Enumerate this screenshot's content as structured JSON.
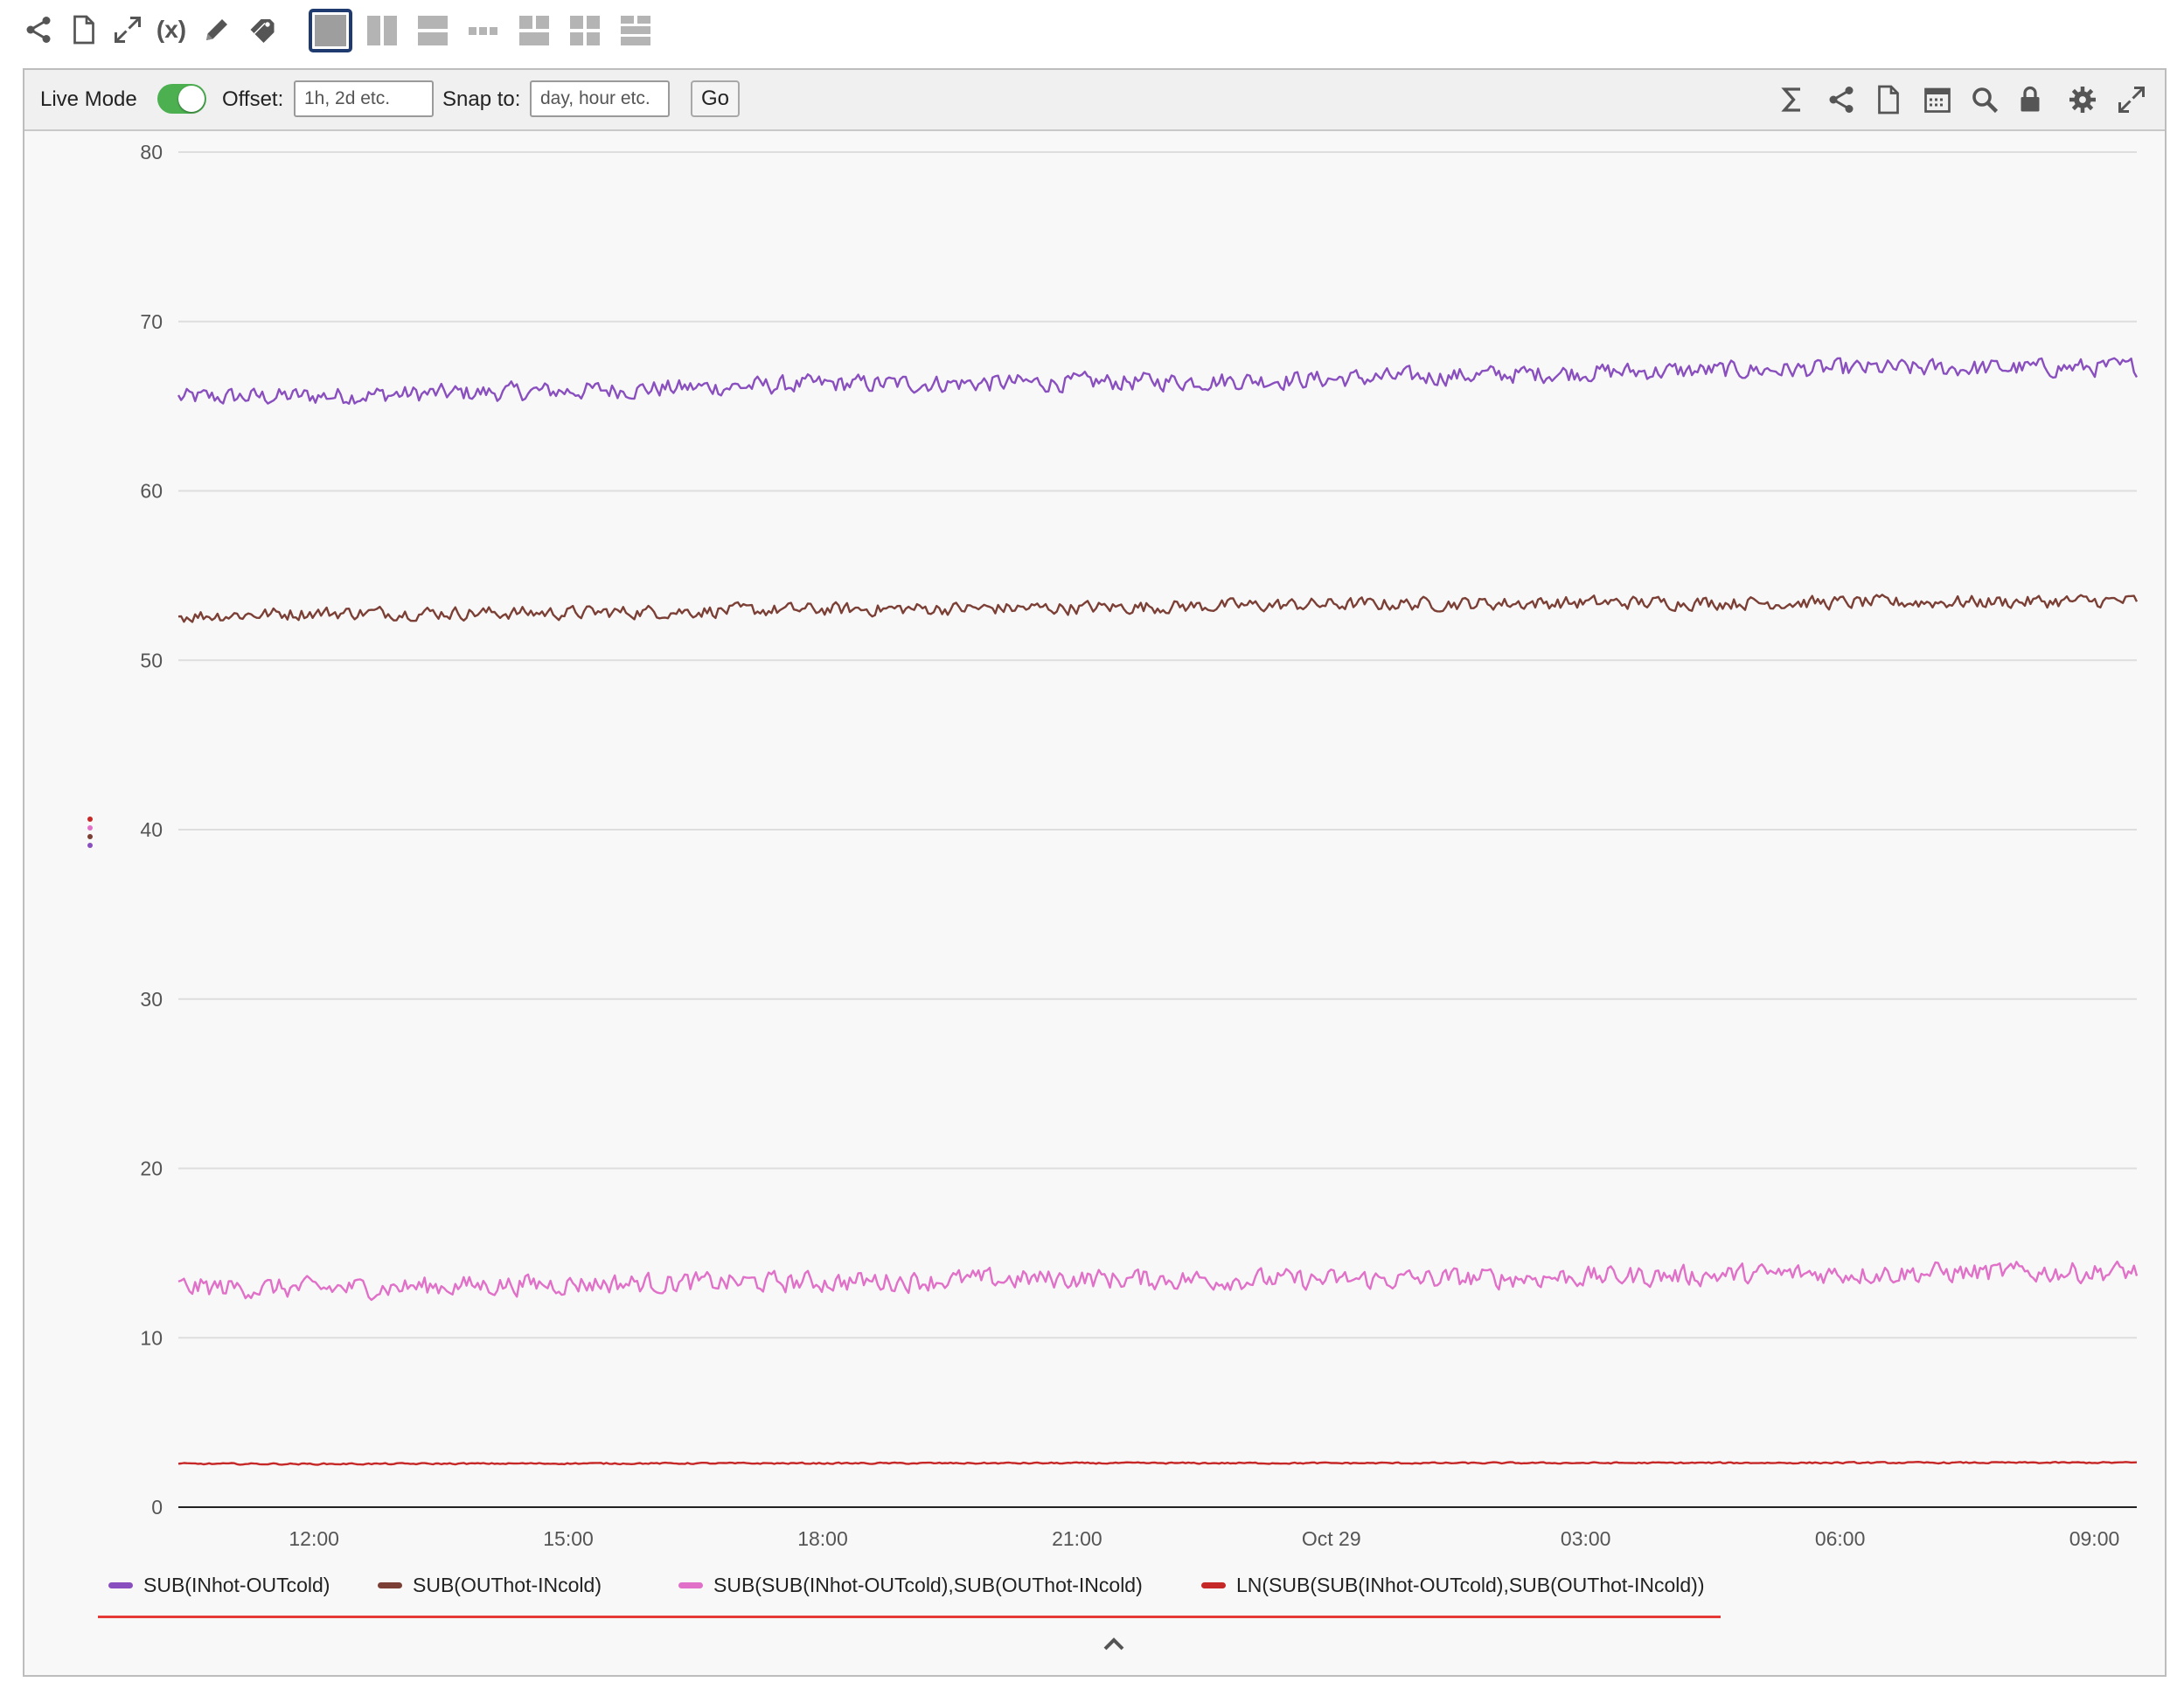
{
  "toolbar": {
    "icons": [
      "share-icon",
      "document-icon",
      "expand-icon",
      "variables-icon",
      "pencil-icon",
      "tag-icon"
    ],
    "variables_text": "(x)",
    "layouts": [
      "single",
      "two-columns",
      "two-rows",
      "three-columns",
      "grid-2x2",
      "grid-2x3",
      "mixed-grid"
    ],
    "selected_layout": "single"
  },
  "panel_toolbar": {
    "live_mode_label": "Live Mode",
    "live_mode_on": true,
    "offset_label": "Offset:",
    "offset_placeholder": "1h, 2d etc.",
    "snap_label": "Snap to:",
    "snap_placeholder": "day, hour etc.",
    "go_label": "Go",
    "right_icons": [
      "sigma-icon",
      "share-icon",
      "document-icon",
      "calendar-icon",
      "search-icon",
      "lock-icon",
      "gear-icon",
      "fullscreen-icon"
    ]
  },
  "colors": {
    "toggle_on": "#4caf50",
    "legend_underline": "#e53935"
  },
  "chart_data": {
    "type": "line",
    "xlabel": "",
    "ylabel": "",
    "x_ticks": [
      "12:00",
      "15:00",
      "18:00",
      "21:00",
      "Oct 29",
      "03:00",
      "06:00",
      "09:00"
    ],
    "x_tick_hours": [
      12,
      15,
      18,
      21,
      24,
      27,
      30,
      33
    ],
    "x_range_hours": [
      10.4,
      33.5
    ],
    "y_ticks": [
      0,
      10,
      20,
      30,
      40,
      50,
      60,
      70,
      80
    ],
    "ylim": [
      0,
      80
    ],
    "grid": true,
    "legend_position": "bottom",
    "series": [
      {
        "name": "SUB(INhot-OUTcold)",
        "color": "#8a4fbf",
        "x_hours": [
          10.4,
          12,
          15,
          18,
          21,
          24,
          27,
          30,
          33.5
        ],
        "values": [
          65.5,
          65.6,
          65.9,
          66.3,
          66.4,
          66.6,
          67.0,
          67.2,
          67.3
        ],
        "noise": 0.75
      },
      {
        "name": "SUB(OUThot-INcold)",
        "color": "#7b3f35",
        "x_hours": [
          10.4,
          12,
          15,
          18,
          21,
          24,
          27,
          30,
          33.5
        ],
        "values": [
          52.6,
          52.8,
          52.8,
          53.0,
          53.1,
          53.3,
          53.4,
          53.4,
          53.5
        ],
        "noise": 0.55
      },
      {
        "name": "SUB(SUB(INhot-OUTcold),SUB(OUThot-INcold)",
        "color": "#e070c8",
        "x_hours": [
          10.4,
          12,
          15,
          18,
          21,
          24,
          27,
          30,
          33.5
        ],
        "values": [
          13.0,
          12.9,
          13.2,
          13.3,
          13.5,
          13.4,
          13.6,
          13.8,
          13.9
        ],
        "noise": 0.85
      },
      {
        "name": "LN(SUB(SUB(INhot-OUTcold),SUB(OUThot-INcold))",
        "color": "#c62828",
        "x_hours": [
          10.4,
          12,
          15,
          18,
          21,
          24,
          27,
          30,
          33.5
        ],
        "values": [
          2.56,
          2.55,
          2.58,
          2.59,
          2.6,
          2.6,
          2.61,
          2.62,
          2.63
        ],
        "noise": 0.06
      }
    ]
  }
}
